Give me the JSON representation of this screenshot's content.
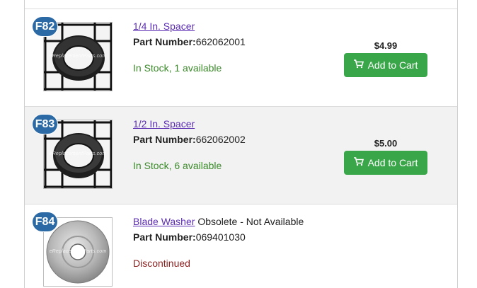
{
  "products": [
    {
      "badge": "F82",
      "name": "1/4 In. Spacer",
      "status_suffix": "",
      "part_label": "Part Number:",
      "part_number": "662062001",
      "stock": "In Stock, 1 available",
      "price": "$4.99",
      "button": "Add to Cart",
      "image_watermark": "eReplacementParts.com"
    },
    {
      "badge": "F83",
      "name": "1/2 In. Spacer",
      "status_suffix": "",
      "part_label": "Part Number:",
      "part_number": "662062002",
      "stock": "In Stock, 6 available",
      "price": "$5.00",
      "button": "Add to Cart",
      "image_watermark": "eReplacementParts.com"
    },
    {
      "badge": "F84",
      "name": "Blade Washer",
      "status_suffix": "Obsolete - Not Available",
      "part_label": "Part Number:",
      "part_number": "069401030",
      "stock": "Discontinued",
      "image_watermark": "eReplacementParts.com"
    }
  ],
  "colors": {
    "badge": "#2c6aa5",
    "link": "#5b2db3",
    "in_stock": "#3b8a2a",
    "discontinued": "#8a1f1f",
    "button": "#3aa64a"
  },
  "icons": {
    "cart": "shopping-cart-icon"
  }
}
